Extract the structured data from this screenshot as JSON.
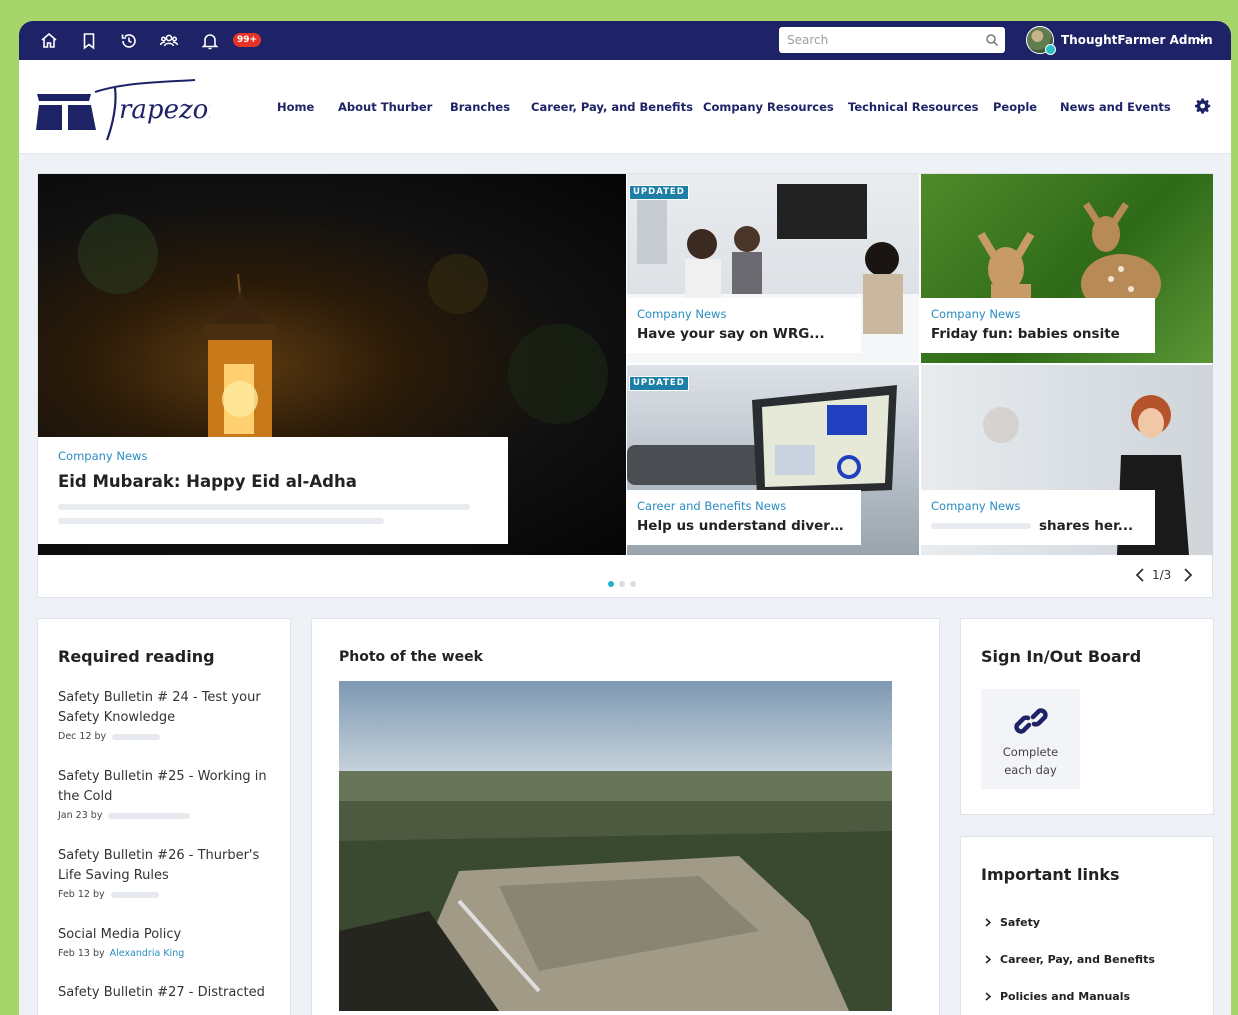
{
  "topbar": {
    "notification_badge": "99+",
    "search_placeholder": "Search",
    "user_name": "ThoughtFarmer Admin",
    "bg_color": "#1d2366"
  },
  "header": {
    "logo_text": "Trapezoid",
    "nav": [
      "Home",
      "About Thurber",
      "Branches",
      "Career, Pay, and Benefits",
      "Company Resources",
      "Technical Resources",
      "People",
      "News and Events"
    ]
  },
  "carousel": {
    "main": {
      "category": "Company News",
      "title": "Eid Mubarak: Happy Eid al-Adha"
    },
    "tiles": [
      {
        "category": "Company News",
        "title": "Have your say on WRG...",
        "badge": "UPDATED"
      },
      {
        "category": "Company News",
        "title": "Friday fun: babies onsite",
        "badge": ""
      },
      {
        "category": "Career and Benefits News",
        "title": "Help us understand diversity ...",
        "badge": "UPDATED"
      },
      {
        "category": "Company News",
        "title": "shares her...",
        "badge": ""
      }
    ],
    "page": "1/3",
    "accent": "#1fb6c4"
  },
  "required_reading": {
    "title": "Required reading",
    "items": [
      {
        "title": "Safety Bulletin # 24 - Test your Safety Knowledge",
        "date": "Dec 12",
        "by": "by",
        "author": ""
      },
      {
        "title": "Safety Bulletin #25 - Working in the Cold",
        "date": "Jan 23",
        "by": "by",
        "author": ""
      },
      {
        "title": "Safety Bulletin #26 - Thurber's Life Saving Rules",
        "date": "Feb 12",
        "by": "by",
        "author": ""
      },
      {
        "title": "Social Media Policy",
        "date": "Feb 13",
        "by": "by",
        "author": "Alexandria King"
      },
      {
        "title": "Safety Bulletin #27 - Distracted",
        "date": "",
        "by": "",
        "author": ""
      }
    ]
  },
  "photo_of_week": {
    "title": "Photo of the week"
  },
  "sign_board": {
    "title": "Sign In/Out Board",
    "tile_label": "Complete each day"
  },
  "important_links": {
    "title": "Important links",
    "items": [
      "Safety",
      "Career, Pay, and Benefits",
      "Policies and Manuals"
    ]
  }
}
